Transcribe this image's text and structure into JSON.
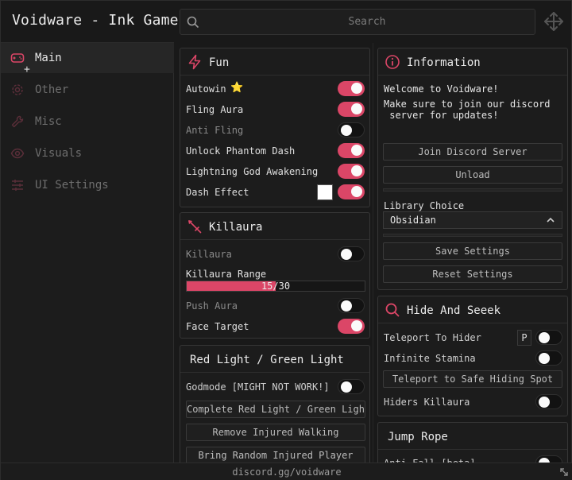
{
  "app": {
    "title": "Voidware - Ink Game",
    "footer": "discord.gg/voidware"
  },
  "search": {
    "placeholder": "Search"
  },
  "accent": "#db4667",
  "sidebar": {
    "items": [
      {
        "label": "Main",
        "icon": "gamepad-icon",
        "active": true
      },
      {
        "label": "Other",
        "icon": "gear-icon",
        "active": false
      },
      {
        "label": "Misc",
        "icon": "wrench-icon",
        "active": false
      },
      {
        "label": "Visuals",
        "icon": "eye-icon",
        "active": false
      },
      {
        "label": "UI Settings",
        "icon": "sliders-icon",
        "active": false
      }
    ]
  },
  "fun": {
    "title": "Fun",
    "icon": "lightning-icon",
    "rows": [
      {
        "label": "Autowin",
        "on": true,
        "star": "⭐"
      },
      {
        "label": "Fling Aura",
        "on": true
      },
      {
        "label": "Anti Fling",
        "on": false
      },
      {
        "label": "Unlock Phantom Dash",
        "on": true
      },
      {
        "label": "Lightning God Awakening",
        "on": true
      },
      {
        "label": "Dash Effect",
        "on": true,
        "color": "#ffffff"
      }
    ]
  },
  "killaura": {
    "title": "Killaura",
    "icon": "sword-icon",
    "toggle_label": "Killaura",
    "toggle_on": false,
    "range_label": "Killaura Range",
    "range_value": 15,
    "range_max": 30,
    "range_text": "15/30",
    "push_label": "Push Aura",
    "push_on": false,
    "face_label": "Face Target",
    "face_on": true
  },
  "rlgl": {
    "title": "Red Light / Green Light",
    "godmode_label": "Godmode [MIGHT NOT WORK!]",
    "godmode_on": false,
    "buttons": [
      "Complete Red Light / Green Light",
      "Remove Injured Walking",
      "Bring Random Injured Player"
    ]
  },
  "information": {
    "title": "Information",
    "icon": "info-icon",
    "line1": "Welcome to Voidware!",
    "line2": "Make sure to join our discord",
    "line3": " server for updates!",
    "join_button": "Join Discord Server",
    "unload_button": "Unload",
    "library_label": "Library Choice",
    "library_value": "Obsidian",
    "save_button": "Save Settings",
    "reset_button": "Reset Settings"
  },
  "hide": {
    "title": "Hide And Seeek",
    "icon": "search-icon",
    "teleport_label": "Teleport To Hider",
    "teleport_key": "P",
    "teleport_on": false,
    "stamina_label": "Infinite Stamina",
    "stamina_on": false,
    "safe_button": "Teleport to Safe Hiding Spot",
    "hiders_label": "Hiders Killaura",
    "hiders_on": false
  },
  "jump": {
    "title": "Jump Rope",
    "antifall_label": "Anti Fall [beta]",
    "antifall_on": false
  }
}
